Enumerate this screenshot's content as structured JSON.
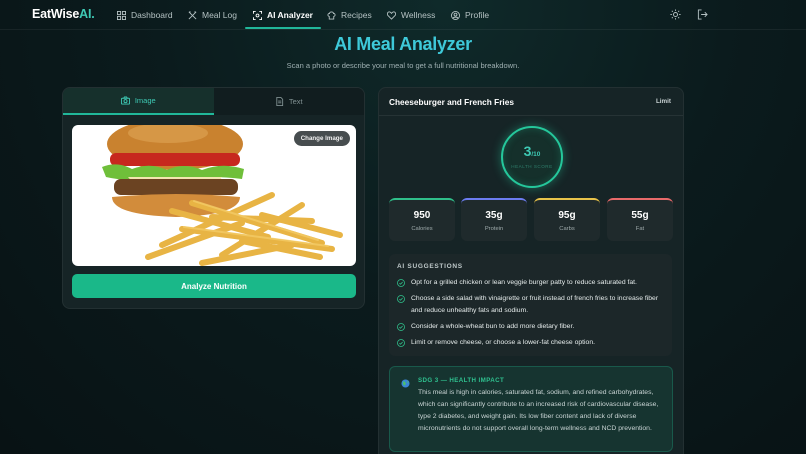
{
  "nav": {
    "logo_main": "EatWise",
    "logo_accent": "AI.",
    "items": [
      {
        "label": "Dashboard",
        "icon": "grid-icon"
      },
      {
        "label": "Meal Log",
        "icon": "utensils-icon"
      },
      {
        "label": "AI Analyzer",
        "icon": "scan-icon",
        "active": true
      },
      {
        "label": "Recipes",
        "icon": "chef-hat-icon"
      },
      {
        "label": "Wellness",
        "icon": "heart-icon"
      },
      {
        "label": "Profile",
        "icon": "user-icon"
      }
    ],
    "theme_icon": "sun-icon",
    "logout_icon": "logout-icon"
  },
  "header": {
    "title": "AI Meal Analyzer",
    "subtitle": "Scan a photo or describe your meal to get a full nutritional breakdown."
  },
  "input_panel": {
    "tabs": [
      {
        "label": "Image",
        "icon": "camera-icon",
        "active": true
      },
      {
        "label": "Text",
        "icon": "document-icon",
        "active": false
      }
    ],
    "change_image_label": "Change Image",
    "analyze_label": "Analyze Nutrition"
  },
  "result": {
    "meal_name": "Cheeseburger and French Fries",
    "tag": "Limit",
    "score": "3",
    "score_max": "/10",
    "score_label": "HEALTH SCORE",
    "stats": [
      {
        "value": "950",
        "label": "Calories",
        "color": "#2fbf8a"
      },
      {
        "value": "35g",
        "label": "Protein",
        "color": "#6c7cf0"
      },
      {
        "value": "95g",
        "label": "Carbs",
        "color": "#e8c34a"
      },
      {
        "value": "55g",
        "label": "Fat",
        "color": "#e86a6a"
      }
    ],
    "suggestions_title": "AI SUGGESTIONS",
    "suggestions": [
      "Opt for a grilled chicken or lean veggie burger patty to reduce saturated fat.",
      "Choose a side salad with vinaigrette or fruit instead of french fries to increase fiber and reduce unhealthy fats and sodium.",
      "Consider a whole-wheat bun to add more dietary fiber.",
      "Limit or remove cheese, or choose a lower-fat cheese option."
    ],
    "impact_title": "SDG 3 — HEALTH IMPACT",
    "impact_text": "This meal is high in calories, saturated fat, sodium, and refined carbohydrates, which can significantly contribute to an increased risk of cardiovascular disease, type 2 diabetes, and weight gain. Its low fiber content and lack of diverse micronutrients do not support overall long-term wellness and NCD prevention."
  },
  "colors": {
    "accent": "#21b79a",
    "title": "#3ec9d9",
    "button": "#1ab889"
  }
}
